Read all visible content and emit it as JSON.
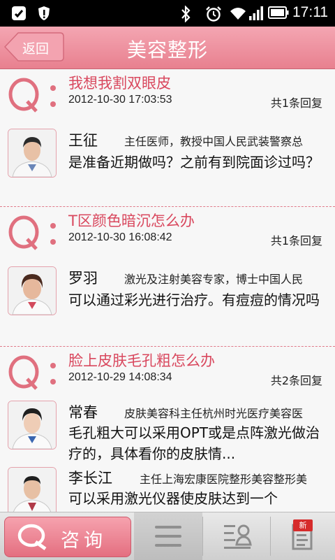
{
  "status_bar": {
    "time": "17:11"
  },
  "header": {
    "back_label": "返回",
    "title": "美容整形"
  },
  "questions": [
    {
      "title": "我想我割双眼皮",
      "date": "2012-10-30 17:03:53",
      "replies": "共1条回复",
      "answers": [
        {
          "doctor": "王征",
          "doctor_title": "主任医师，教授中国人民武装警察总",
          "text": "是准备近期做吗？之前有到院面诊过吗？"
        }
      ]
    },
    {
      "title": "T区颜色暗沉怎么办",
      "date": "2012-10-30 16:08:42",
      "replies": "共1条回复",
      "answers": [
        {
          "doctor": "罗羽",
          "doctor_title": "激光及注射美容专家，博士中国人民",
          "text": "可以通过彩光进行治疗。有痘痘的情况吗"
        }
      ]
    },
    {
      "title": "脸上皮肤毛孔粗怎么办",
      "date": "2012-10-29 14:08:34",
      "replies": "共2条回复",
      "answers": [
        {
          "doctor": "常春",
          "doctor_title": "皮肤美容科主任杭州时光医疗美容医",
          "text": "毛孔粗大可以采用OPT或是点阵激光做治疗的，具体看你的皮肤情..."
        },
        {
          "doctor": "李长江",
          "doctor_title": "主任上海宏康医院整形美容整形美",
          "text": "可以采用激光仪器使皮肤达到一个"
        }
      ]
    }
  ],
  "toolbar": {
    "consult_label": "咨询",
    "new_badge": "新"
  },
  "colors": {
    "accent": "#e46f80",
    "title_red": "#d9485e"
  }
}
